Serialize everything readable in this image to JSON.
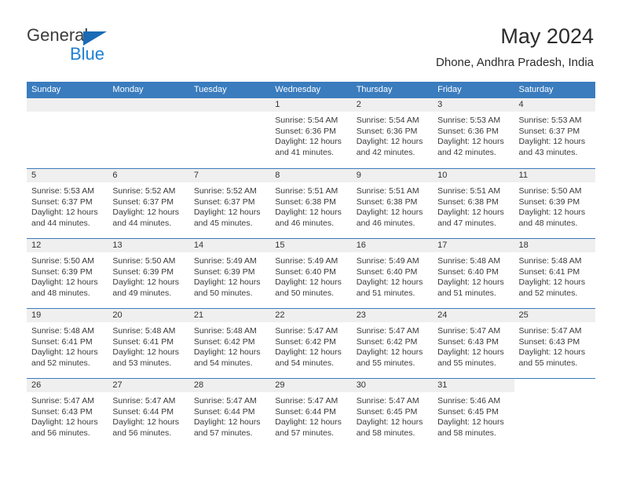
{
  "brand": {
    "name_top": "General",
    "name_bottom": "Blue"
  },
  "header": {
    "title": "May 2024",
    "location": "Dhone, Andhra Pradesh, India"
  },
  "weekdays": [
    "Sunday",
    "Monday",
    "Tuesday",
    "Wednesday",
    "Thursday",
    "Friday",
    "Saturday"
  ],
  "colors": {
    "header_blue": "#3a7cbe",
    "brand_blue": "#1f7fd1",
    "day_band_gray": "#efefef"
  },
  "weeks": [
    [
      {
        "day": "",
        "lines": []
      },
      {
        "day": "",
        "lines": []
      },
      {
        "day": "",
        "lines": []
      },
      {
        "day": "1",
        "lines": [
          "Sunrise: 5:54 AM",
          "Sunset: 6:36 PM",
          "Daylight: 12 hours",
          "and 41 minutes."
        ]
      },
      {
        "day": "2",
        "lines": [
          "Sunrise: 5:54 AM",
          "Sunset: 6:36 PM",
          "Daylight: 12 hours",
          "and 42 minutes."
        ]
      },
      {
        "day": "3",
        "lines": [
          "Sunrise: 5:53 AM",
          "Sunset: 6:36 PM",
          "Daylight: 12 hours",
          "and 42 minutes."
        ]
      },
      {
        "day": "4",
        "lines": [
          "Sunrise: 5:53 AM",
          "Sunset: 6:37 PM",
          "Daylight: 12 hours",
          "and 43 minutes."
        ]
      }
    ],
    [
      {
        "day": "5",
        "lines": [
          "Sunrise: 5:53 AM",
          "Sunset: 6:37 PM",
          "Daylight: 12 hours",
          "and 44 minutes."
        ]
      },
      {
        "day": "6",
        "lines": [
          "Sunrise: 5:52 AM",
          "Sunset: 6:37 PM",
          "Daylight: 12 hours",
          "and 44 minutes."
        ]
      },
      {
        "day": "7",
        "lines": [
          "Sunrise: 5:52 AM",
          "Sunset: 6:37 PM",
          "Daylight: 12 hours",
          "and 45 minutes."
        ]
      },
      {
        "day": "8",
        "lines": [
          "Sunrise: 5:51 AM",
          "Sunset: 6:38 PM",
          "Daylight: 12 hours",
          "and 46 minutes."
        ]
      },
      {
        "day": "9",
        "lines": [
          "Sunrise: 5:51 AM",
          "Sunset: 6:38 PM",
          "Daylight: 12 hours",
          "and 46 minutes."
        ]
      },
      {
        "day": "10",
        "lines": [
          "Sunrise: 5:51 AM",
          "Sunset: 6:38 PM",
          "Daylight: 12 hours",
          "and 47 minutes."
        ]
      },
      {
        "day": "11",
        "lines": [
          "Sunrise: 5:50 AM",
          "Sunset: 6:39 PM",
          "Daylight: 12 hours",
          "and 48 minutes."
        ]
      }
    ],
    [
      {
        "day": "12",
        "lines": [
          "Sunrise: 5:50 AM",
          "Sunset: 6:39 PM",
          "Daylight: 12 hours",
          "and 48 minutes."
        ]
      },
      {
        "day": "13",
        "lines": [
          "Sunrise: 5:50 AM",
          "Sunset: 6:39 PM",
          "Daylight: 12 hours",
          "and 49 minutes."
        ]
      },
      {
        "day": "14",
        "lines": [
          "Sunrise: 5:49 AM",
          "Sunset: 6:39 PM",
          "Daylight: 12 hours",
          "and 50 minutes."
        ]
      },
      {
        "day": "15",
        "lines": [
          "Sunrise: 5:49 AM",
          "Sunset: 6:40 PM",
          "Daylight: 12 hours",
          "and 50 minutes."
        ]
      },
      {
        "day": "16",
        "lines": [
          "Sunrise: 5:49 AM",
          "Sunset: 6:40 PM",
          "Daylight: 12 hours",
          "and 51 minutes."
        ]
      },
      {
        "day": "17",
        "lines": [
          "Sunrise: 5:48 AM",
          "Sunset: 6:40 PM",
          "Daylight: 12 hours",
          "and 51 minutes."
        ]
      },
      {
        "day": "18",
        "lines": [
          "Sunrise: 5:48 AM",
          "Sunset: 6:41 PM",
          "Daylight: 12 hours",
          "and 52 minutes."
        ]
      }
    ],
    [
      {
        "day": "19",
        "lines": [
          "Sunrise: 5:48 AM",
          "Sunset: 6:41 PM",
          "Daylight: 12 hours",
          "and 52 minutes."
        ]
      },
      {
        "day": "20",
        "lines": [
          "Sunrise: 5:48 AM",
          "Sunset: 6:41 PM",
          "Daylight: 12 hours",
          "and 53 minutes."
        ]
      },
      {
        "day": "21",
        "lines": [
          "Sunrise: 5:48 AM",
          "Sunset: 6:42 PM",
          "Daylight: 12 hours",
          "and 54 minutes."
        ]
      },
      {
        "day": "22",
        "lines": [
          "Sunrise: 5:47 AM",
          "Sunset: 6:42 PM",
          "Daylight: 12 hours",
          "and 54 minutes."
        ]
      },
      {
        "day": "23",
        "lines": [
          "Sunrise: 5:47 AM",
          "Sunset: 6:42 PM",
          "Daylight: 12 hours",
          "and 55 minutes."
        ]
      },
      {
        "day": "24",
        "lines": [
          "Sunrise: 5:47 AM",
          "Sunset: 6:43 PM",
          "Daylight: 12 hours",
          "and 55 minutes."
        ]
      },
      {
        "day": "25",
        "lines": [
          "Sunrise: 5:47 AM",
          "Sunset: 6:43 PM",
          "Daylight: 12 hours",
          "and 55 minutes."
        ]
      }
    ],
    [
      {
        "day": "26",
        "lines": [
          "Sunrise: 5:47 AM",
          "Sunset: 6:43 PM",
          "Daylight: 12 hours",
          "and 56 minutes."
        ]
      },
      {
        "day": "27",
        "lines": [
          "Sunrise: 5:47 AM",
          "Sunset: 6:44 PM",
          "Daylight: 12 hours",
          "and 56 minutes."
        ]
      },
      {
        "day": "28",
        "lines": [
          "Sunrise: 5:47 AM",
          "Sunset: 6:44 PM",
          "Daylight: 12 hours",
          "and 57 minutes."
        ]
      },
      {
        "day": "29",
        "lines": [
          "Sunrise: 5:47 AM",
          "Sunset: 6:44 PM",
          "Daylight: 12 hours",
          "and 57 minutes."
        ]
      },
      {
        "day": "30",
        "lines": [
          "Sunrise: 5:47 AM",
          "Sunset: 6:45 PM",
          "Daylight: 12 hours",
          "and 58 minutes."
        ]
      },
      {
        "day": "31",
        "lines": [
          "Sunrise: 5:46 AM",
          "Sunset: 6:45 PM",
          "Daylight: 12 hours",
          "and 58 minutes."
        ]
      },
      {
        "day": "",
        "lines": [],
        "blank": true
      }
    ]
  ]
}
